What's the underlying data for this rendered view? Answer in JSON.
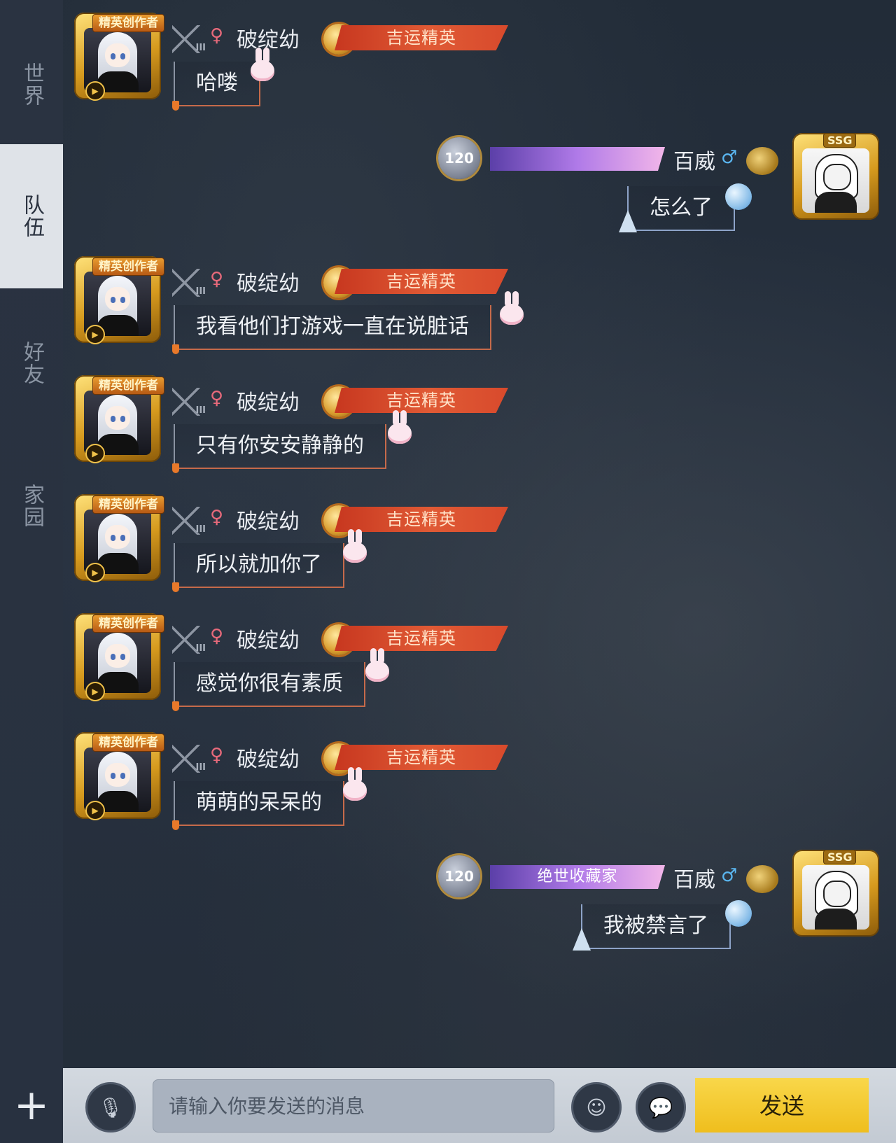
{
  "sidebar": {
    "tabs": [
      {
        "label": "世界",
        "active": false
      },
      {
        "label": "队伍",
        "active": true
      },
      {
        "label": "好友",
        "active": false
      },
      {
        "label": "家园",
        "active": false
      }
    ]
  },
  "avatar_badge": "精英创作者",
  "player_left": {
    "name": "破绽幼",
    "gender": "♀",
    "title": "吉运精英",
    "rank": "III"
  },
  "player_right": {
    "name": "百威",
    "gender": "♂",
    "level": "120",
    "title": "绝世收藏家",
    "frame": "SSG"
  },
  "messages": [
    {
      "side": "left",
      "text": "哈喽"
    },
    {
      "side": "right",
      "text": "怎么了"
    },
    {
      "side": "left",
      "text": "我看他们打游戏一直在说脏话"
    },
    {
      "side": "left",
      "text": "只有你安安静静的"
    },
    {
      "side": "left",
      "text": "所以就加你了"
    },
    {
      "side": "left",
      "text": "感觉你很有素质"
    },
    {
      "side": "left",
      "text": "萌萌的呆呆的"
    },
    {
      "side": "right",
      "text": "我被禁言了"
    }
  ],
  "input": {
    "placeholder": "请输入你要发送的消息",
    "value": ""
  },
  "send_label": "发送",
  "plus_label": "+",
  "colors": {
    "title_ribbon": "#d84a2c",
    "collector_ribbon": "#b07ae8",
    "send_button": "#f3c62c",
    "active_tab": "#dfe3e8"
  }
}
